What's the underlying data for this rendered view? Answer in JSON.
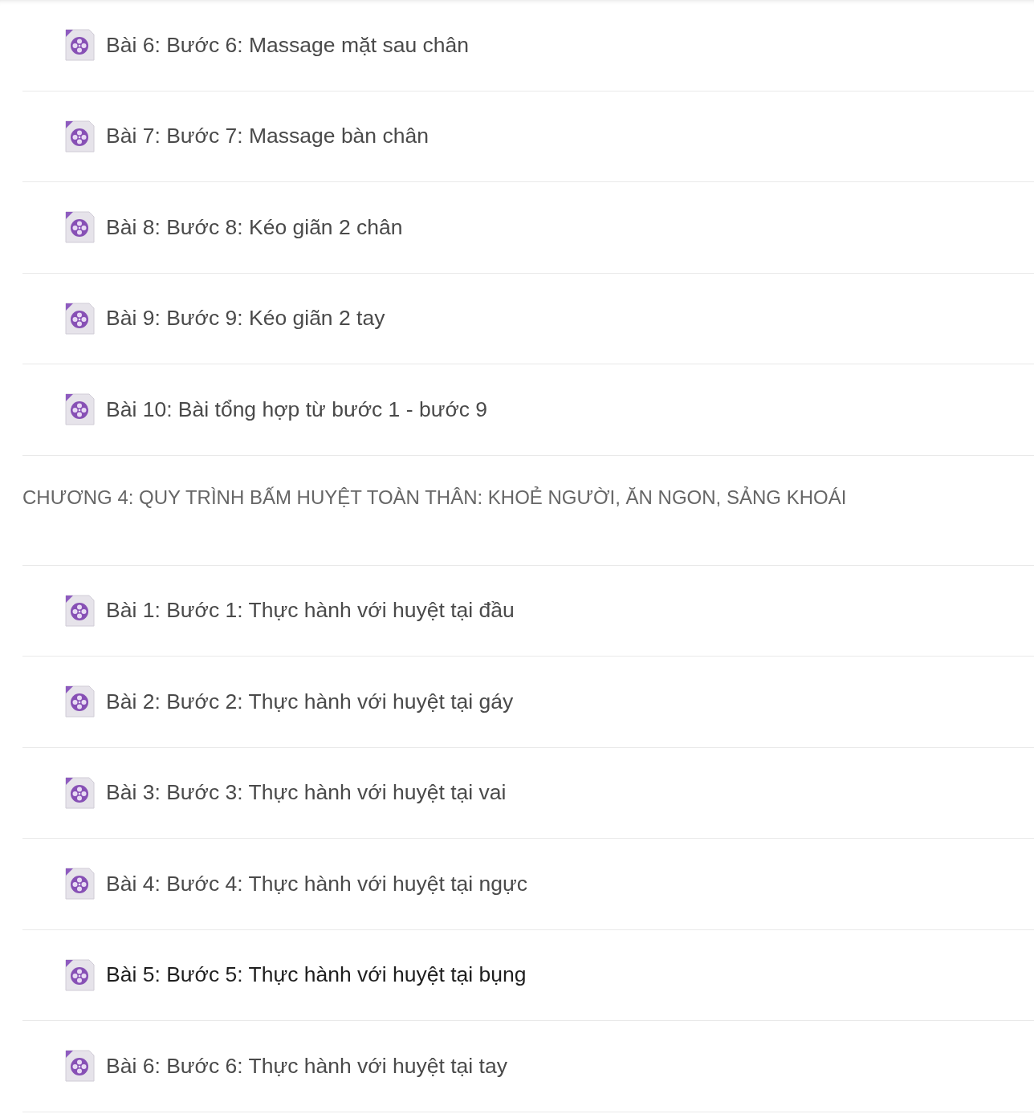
{
  "sections": [
    {
      "lessons": [
        {
          "title": "Bài 6: Bước 6: Massage mặt sau chân",
          "highlighted": false
        },
        {
          "title": "Bài 7: Bước 7: Massage bàn chân",
          "highlighted": false
        },
        {
          "title": "Bài 8: Bước 8: Kéo giãn 2 chân",
          "highlighted": false
        },
        {
          "title": "Bài 9: Bước 9: Kéo giãn 2 tay",
          "highlighted": false
        },
        {
          "title": "Bài 10: Bài tổng hợp từ bước 1 - bước 9",
          "highlighted": false
        }
      ]
    },
    {
      "title": "CHƯƠNG 4: QUY TRÌNH BẤM HUYỆT TOÀN THÂN: KHOẺ NGƯỜI, ĂN NGON, SẢNG KHOÁI",
      "lessons": [
        {
          "title": "Bài 1: Bước 1: Thực hành với huyệt tại đầu",
          "highlighted": false
        },
        {
          "title": "Bài 2: Bước 2: Thực hành với huyệt tại gáy",
          "highlighted": false
        },
        {
          "title": "Bài 3: Bước 3: Thực hành với huyệt tại vai",
          "highlighted": false
        },
        {
          "title": "Bài 4: Bước 4: Thực hành với huyệt tại ngực",
          "highlighted": false
        },
        {
          "title": "Bài 5: Bước 5: Thực hành với huyệt tại bụng",
          "highlighted": true
        },
        {
          "title": "Bài 6: Bước 6: Thực hành với huyệt tại tay",
          "highlighted": false
        }
      ]
    }
  ]
}
